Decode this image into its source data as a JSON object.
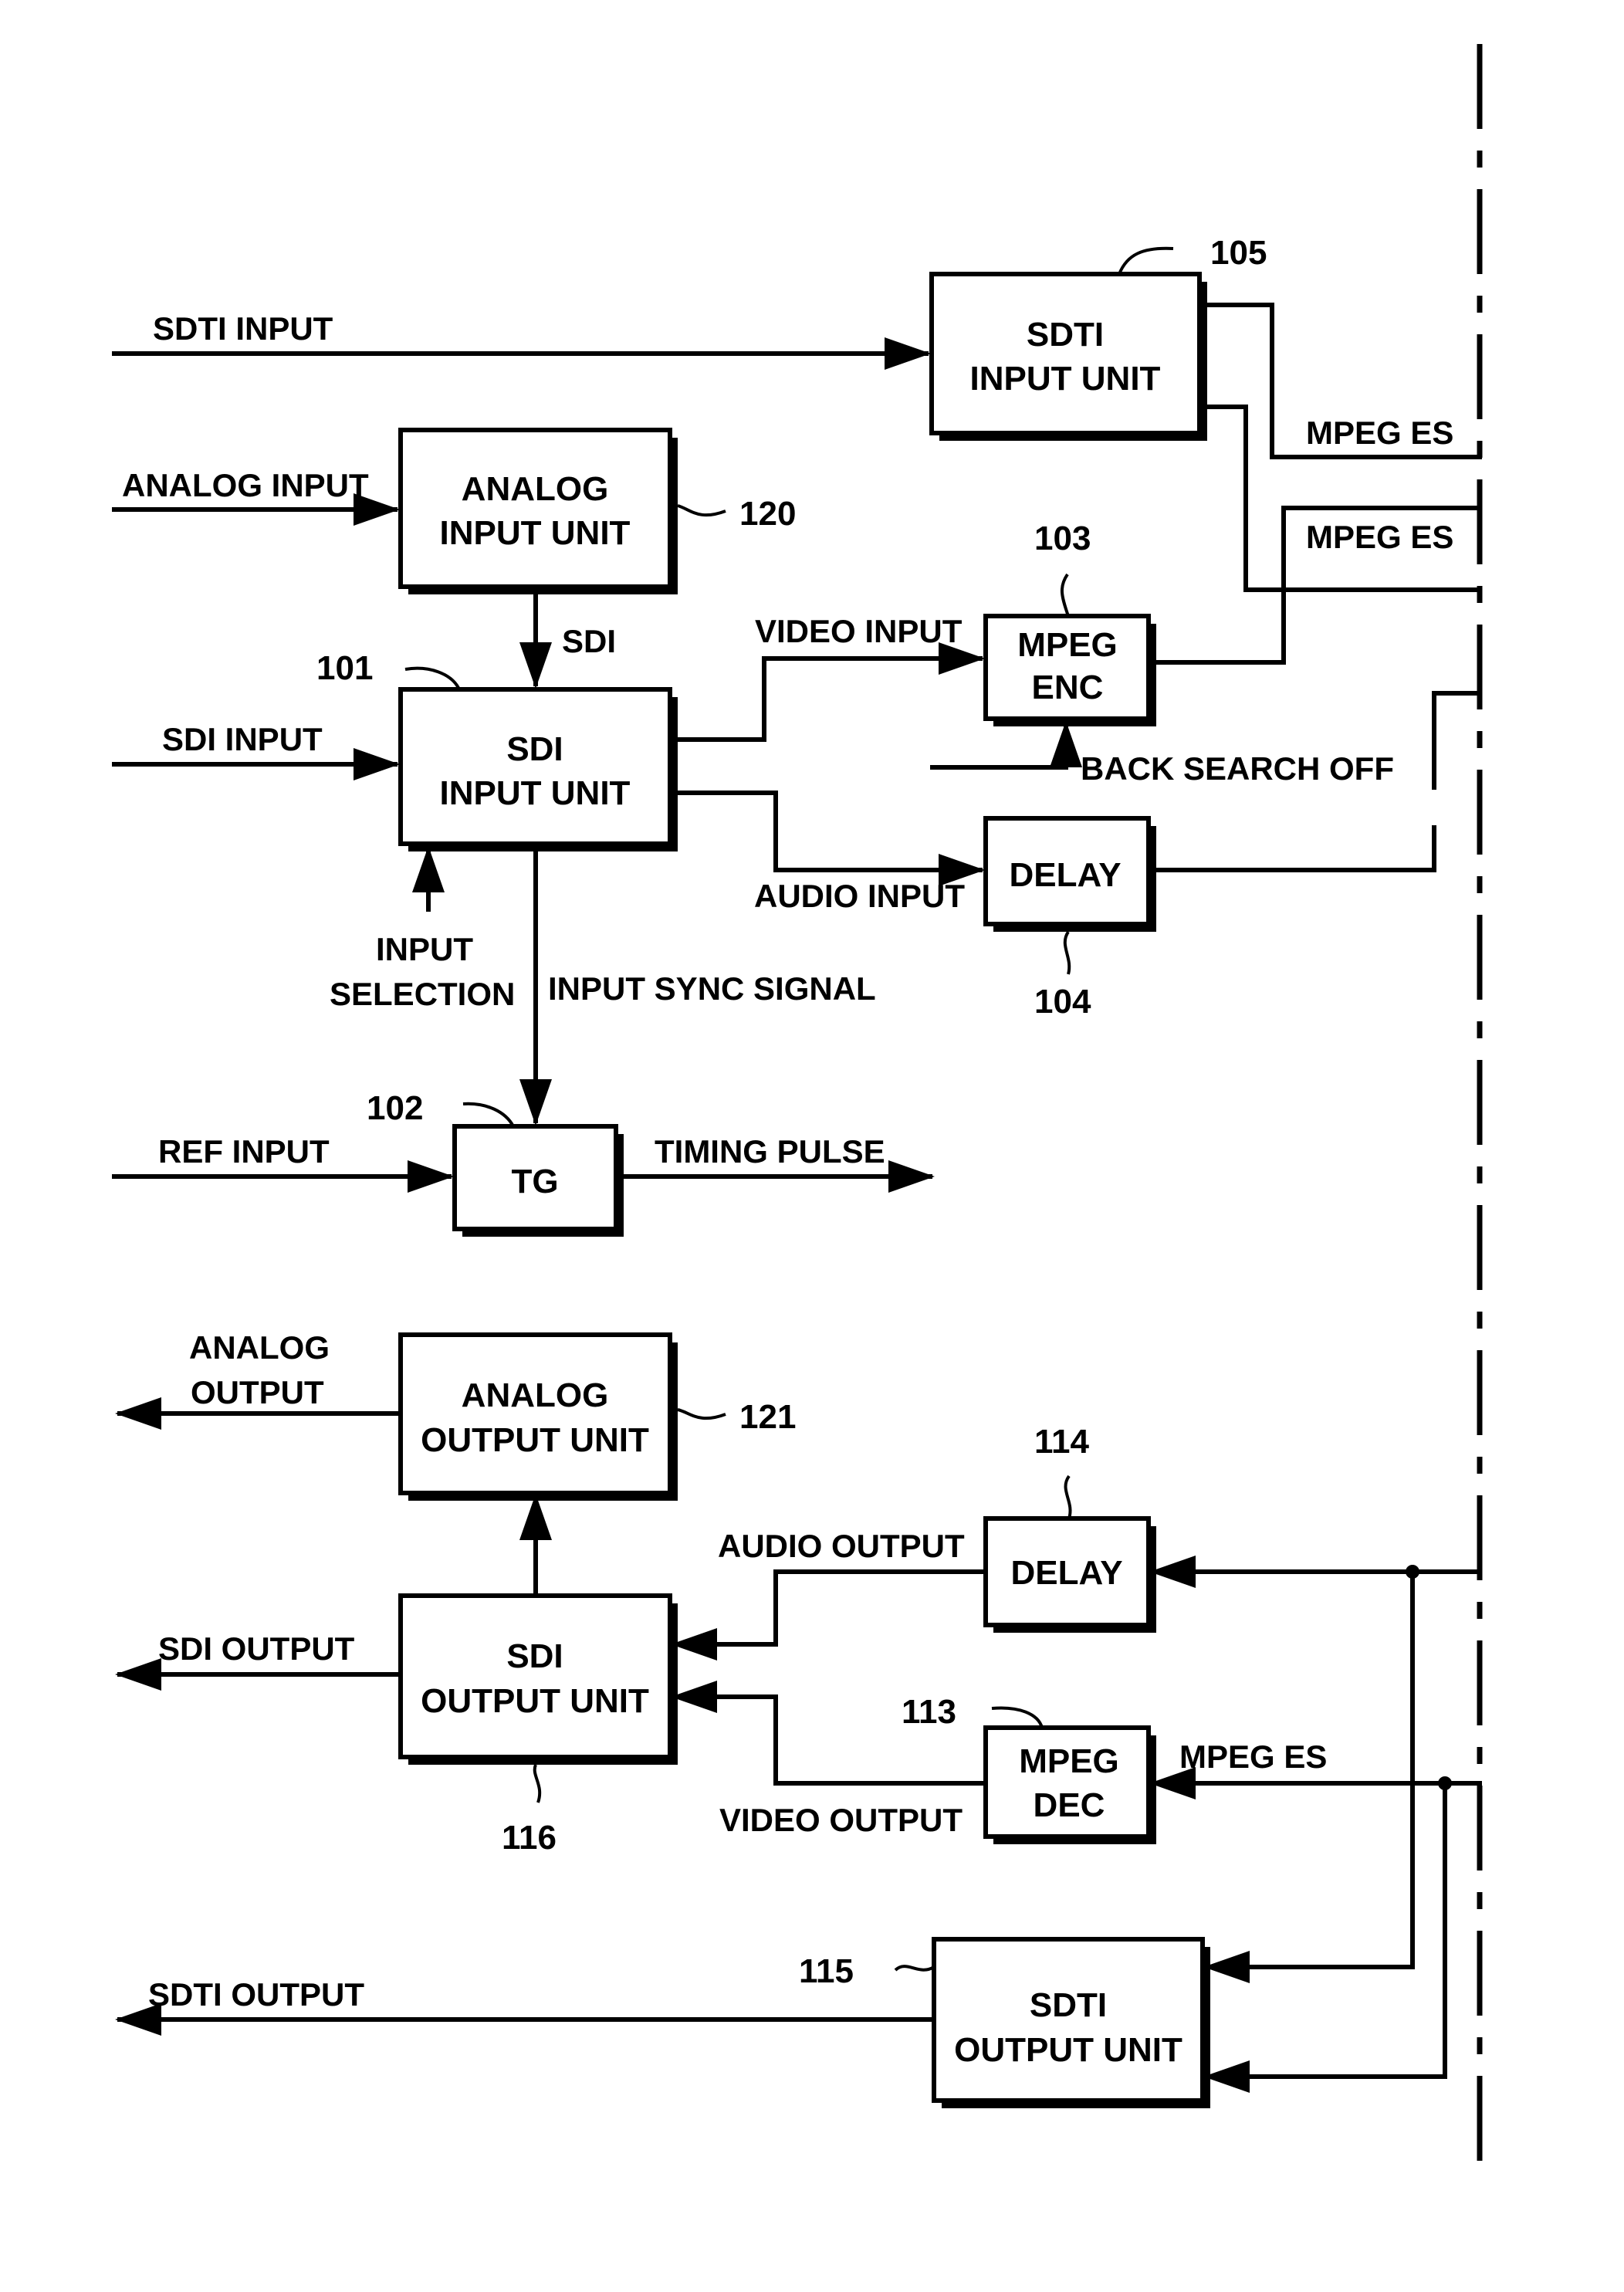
{
  "blocks": {
    "sdti_input_unit": {
      "line1": "SDTI",
      "line2": "INPUT UNIT",
      "ref": "105"
    },
    "analog_input_unit": {
      "line1": "ANALOG",
      "line2": "INPUT UNIT",
      "ref": "120"
    },
    "sdi_input_unit": {
      "line1": "SDI",
      "line2": "INPUT UNIT",
      "ref": "101"
    },
    "mpeg_enc": {
      "line1": "MPEG",
      "line2": "ENC",
      "ref": "103"
    },
    "delay_in": {
      "line1": "DELAY",
      "ref": "104"
    },
    "tg": {
      "line1": "TG",
      "ref": "102"
    },
    "analog_output_unit": {
      "line1": "ANALOG",
      "line2": "OUTPUT UNIT",
      "ref": "121"
    },
    "sdi_output_unit": {
      "line1": "SDI",
      "line2": "OUTPUT UNIT",
      "ref": "116"
    },
    "delay_out": {
      "line1": "DELAY",
      "ref": "114"
    },
    "mpeg_dec": {
      "line1": "MPEG",
      "line2": "DEC",
      "ref": "113"
    },
    "sdti_output_unit": {
      "line1": "SDTI",
      "line2": "OUTPUT UNIT",
      "ref": "115"
    }
  },
  "signals": {
    "sdti_input": "SDTI INPUT",
    "analog_input": "ANALOG INPUT",
    "sdi": "SDI",
    "sdi_input": "SDI INPUT",
    "video_input": "VIDEO INPUT",
    "audio_input": "AUDIO INPUT",
    "back_search_off": "BACK SEARCH OFF",
    "input_selection_1": "INPUT",
    "input_selection_2": "SELECTION",
    "input_sync_signal": "INPUT SYNC SIGNAL",
    "ref_input": "REF INPUT",
    "timing_pulse": "TIMING PULSE",
    "mpeg_es_1": "MPEG ES",
    "mpeg_es_2": "MPEG ES",
    "analog_output_1": "ANALOG",
    "analog_output_2": "OUTPUT",
    "sdi_output": "SDI OUTPUT",
    "audio_output": "AUDIO OUTPUT",
    "video_output": "VIDEO OUTPUT",
    "mpeg_es_3": "MPEG ES",
    "sdti_output": "SDTI OUTPUT"
  }
}
